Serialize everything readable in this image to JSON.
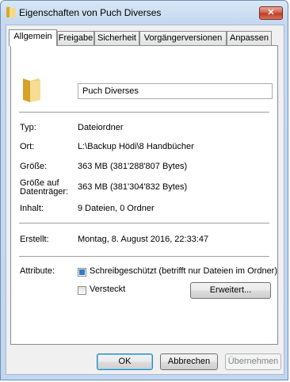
{
  "window": {
    "title": "Eigenschaften von Puch Diverses",
    "close_symbol": "✕"
  },
  "tabs": [
    {
      "label": "Allgemein",
      "active": true
    },
    {
      "label": "Freigabe"
    },
    {
      "label": "Sicherheit"
    },
    {
      "label": "Vorgängerversionen"
    },
    {
      "label": "Anpassen"
    }
  ],
  "general": {
    "folder_name": "Puch Diverses",
    "type_label": "Typ:",
    "type_value": "Dateiordner",
    "location_label": "Ort:",
    "location_value": "L:\\Backup Hödi\\8 Handbücher",
    "size_label": "Größe:",
    "size_value": "363 MB (381'288'807 Bytes)",
    "disk_size_label_line1": "Größe auf",
    "disk_size_label_line2": "Datenträger:",
    "disk_size_value": "363 MB (381'304'832 Bytes)",
    "contents_label": "Inhalt:",
    "contents_value": "9 Dateien, 0 Ordner",
    "created_label": "Erstellt:",
    "created_value": "Montag, 8. August 2016, 22:33:47",
    "attributes_label": "Attribute:",
    "readonly_label": "Schreibgeschützt (betrifft nur Dateien im Ordner)",
    "readonly_state": "partial",
    "hidden_label": "Versteckt",
    "hidden_state": "unchecked",
    "advanced_button": "Erweitert..."
  },
  "footer": {
    "ok": "OK",
    "cancel": "Abbrechen",
    "apply": "Übernehmen"
  }
}
